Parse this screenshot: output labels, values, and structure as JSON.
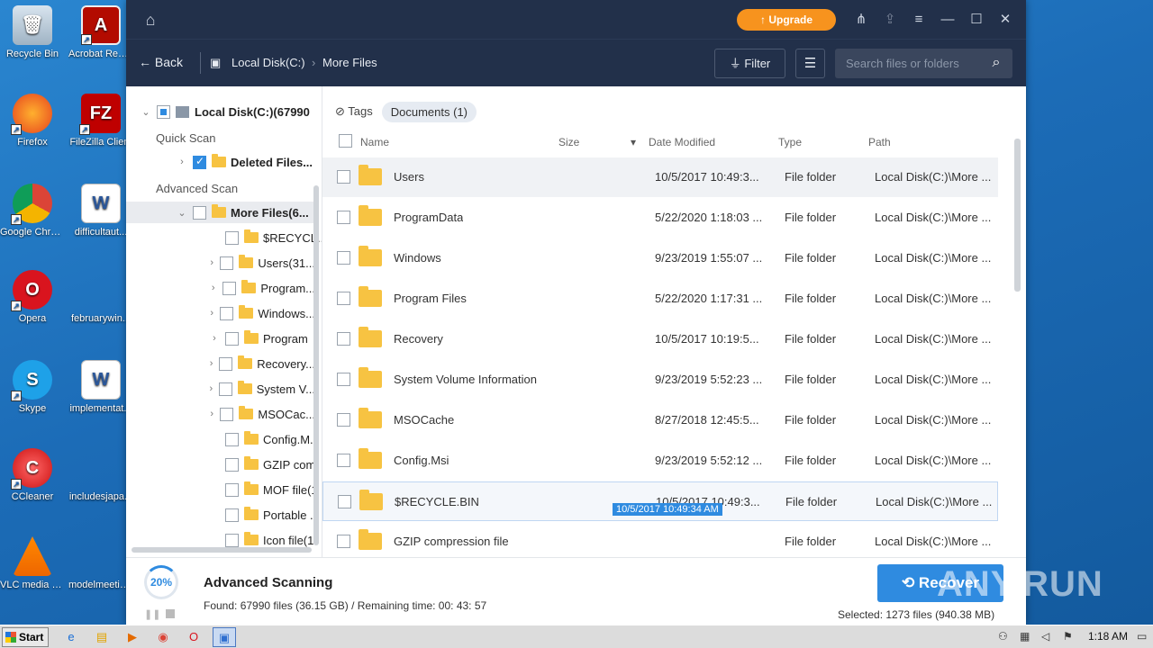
{
  "desktop": {
    "icons_left": [
      {
        "label": "Recycle Bin",
        "icon": "recycle-bin-icon"
      },
      {
        "label": "Firefox",
        "icon": "firefox-icon"
      },
      {
        "label": "Google Chrome",
        "icon": "chrome-icon"
      },
      {
        "label": "Opera",
        "icon": "opera-icon"
      },
      {
        "label": "Skype",
        "icon": "skype-icon"
      },
      {
        "label": "CCleaner",
        "icon": "ccleaner-icon"
      },
      {
        "label": "VLC media player",
        "icon": "vlc-icon"
      }
    ],
    "icons_right": [
      {
        "label": "Acrobat Reader DC",
        "icon": "acrobat-icon"
      },
      {
        "label": "FileZilla Client",
        "icon": "filezilla-icon"
      },
      {
        "label": "difficultaut...",
        "icon": "word-doc-icon"
      },
      {
        "label": "februarywin...",
        "icon": "blank-doc-icon"
      },
      {
        "label": "implementat...",
        "icon": "word-doc-icon"
      },
      {
        "label": "includesjapa...",
        "icon": "blank-doc-icon"
      },
      {
        "label": "modelmeetin...",
        "icon": "blank-doc-icon"
      }
    ]
  },
  "app": {
    "upgrade_label": "Upgrade",
    "back_label": "Back",
    "breadcrumb": [
      "Local Disk(C:)",
      "More Files"
    ],
    "filter_label": "Filter",
    "search_placeholder": "Search files or folders",
    "sidebar": {
      "root": "Local Disk(C:)(67990",
      "quick_scan": "Quick Scan",
      "deleted_files": "Deleted Files...",
      "advanced_scan": "Advanced Scan",
      "more_files": "More Files(6...",
      "children": [
        "$RECYCL...",
        "Users(31...",
        "Program...",
        "Windows...",
        "Program",
        "Recovery...",
        "System V...",
        "MSOCac...",
        "Config.M...",
        "GZIP com",
        "MOF file(1",
        "Portable ...",
        "Icon file(1"
      ]
    },
    "tags_label": "Tags",
    "documents_pill": "Documents (1)",
    "columns": {
      "name": "Name",
      "size": "Size",
      "date": "Date Modified",
      "type": "Type",
      "path": "Path"
    },
    "rows": [
      {
        "name": "Users",
        "date": "10/5/2017 10:49:3...",
        "type": "File folder",
        "path": "Local Disk(C:)\\More ..."
      },
      {
        "name": "ProgramData",
        "date": "5/22/2020 1:18:03 ...",
        "type": "File folder",
        "path": "Local Disk(C:)\\More ..."
      },
      {
        "name": "Windows",
        "date": "9/23/2019 1:55:07 ...",
        "type": "File folder",
        "path": "Local Disk(C:)\\More ..."
      },
      {
        "name": "Program Files",
        "date": "5/22/2020 1:17:31 ...",
        "type": "File folder",
        "path": "Local Disk(C:)\\More ..."
      },
      {
        "name": "Recovery",
        "date": "10/5/2017 10:19:5...",
        "type": "File folder",
        "path": "Local Disk(C:)\\More ..."
      },
      {
        "name": "System Volume Information",
        "date": "9/23/2019 5:52:23 ...",
        "type": "File folder",
        "path": "Local Disk(C:)\\More ..."
      },
      {
        "name": "MSOCache",
        "date": "8/27/2018 12:45:5...",
        "type": "File folder",
        "path": "Local Disk(C:)\\More ..."
      },
      {
        "name": "Config.Msi",
        "date": "9/23/2019 5:52:12 ...",
        "type": "File folder",
        "path": "Local Disk(C:)\\More ..."
      },
      {
        "name": "$RECYCLE.BIN",
        "date": "10/5/2017 10:49:3...",
        "type": "File folder",
        "path": "Local Disk(C:)\\More ..."
      },
      {
        "name": "GZIP compression file",
        "date": "",
        "type": "File folder",
        "path": "Local Disk(C:)\\More ..."
      }
    ],
    "tooltip": "10/5/2017 10:49:34 AM",
    "footer": {
      "progress": "20%",
      "progress_value": 0.2,
      "title": "Advanced Scanning",
      "info": "Found: 67990 files (36.15 GB) / Remaining time: 00: 43: 57",
      "recover_label": "Recover",
      "selected_info": "Selected: 1273 files (940.38 MB)"
    },
    "watermark": "ANY.RUN"
  },
  "taskbar": {
    "start_label": "Start",
    "clock": "1:18 AM"
  }
}
